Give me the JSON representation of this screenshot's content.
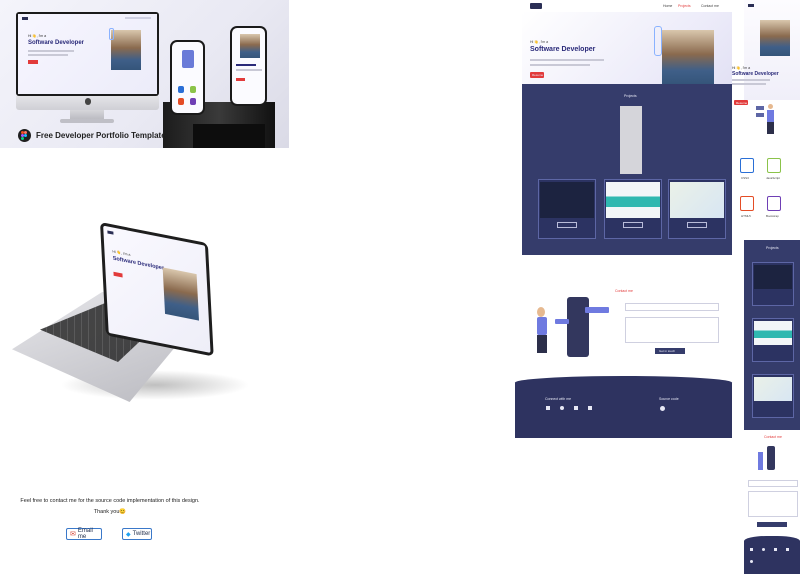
{
  "hero": {
    "caption": "Free Developer Portfolio Template",
    "greeting": "Hi 👋, I'm a",
    "role": "Software Developer",
    "cta": "Resume"
  },
  "laptop": {
    "greeting": "Hi 👋, I'm a",
    "role": "Software Developer"
  },
  "contact_note": {
    "line1": "Feel free to contact me for the source code implementation of this design.",
    "line2": "Thank you😊",
    "email_label": "Email me",
    "twitter_label": "Twitter"
  },
  "preview": {
    "nav": [
      "Home",
      "Projects",
      "Contact me"
    ],
    "greeting": "Hi 👋, I'm a",
    "role": "Software Developer",
    "resume": "Resume",
    "projects_title": "Projects",
    "contact_title": "Contact me",
    "send_label": "Get in touch",
    "footer_left": "Connect with me",
    "footer_right": "Source code",
    "icons": [
      "linkedin-icon",
      "whatsapp-icon",
      "twitter-icon",
      "email-icon",
      "github-icon"
    ]
  },
  "mobile": {
    "greeting": "Hi 👋, I'm a",
    "role": "Software Developer",
    "resume": "Resume",
    "projects_title": "Projects",
    "contact_title": "Contact me",
    "tech": [
      {
        "name": "CSS3",
        "color": "#2a6fd6"
      },
      {
        "name": "JavaScript",
        "color": "#8bc34a"
      },
      {
        "name": "HTML5",
        "color": "#e44d26"
      },
      {
        "name": "Bootstrap",
        "color": "#6f3fb5"
      }
    ]
  },
  "colors": {
    "accent_red": "#e23b3b",
    "navy": "#353c6b",
    "footer_navy": "#2e3360",
    "link_blue": "#3a78c9"
  }
}
